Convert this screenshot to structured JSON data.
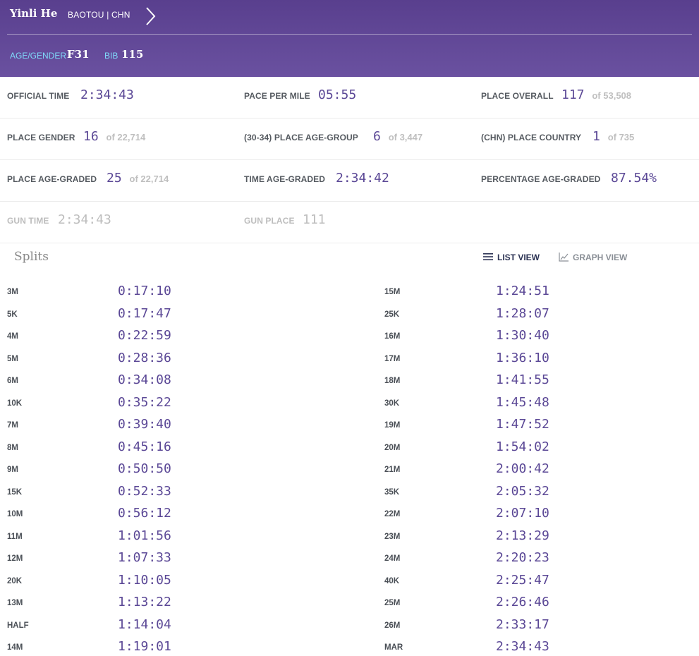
{
  "runner": {
    "name": "Yinli He",
    "location": "BAOTOU | CHN",
    "age_gender_label": "AGE/GENDER",
    "age_gender": "F31",
    "bib_label": "BIB",
    "bib": "115"
  },
  "stats": [
    [
      {
        "label": "OFFICIAL TIME",
        "value": "2:34:43",
        "of": ""
      },
      {
        "label": "PACE PER MILE",
        "value": "05:55",
        "of": ""
      },
      {
        "label": "PLACE OVERALL",
        "value": "117",
        "of": "of 53,508"
      }
    ],
    [
      {
        "label": "PLACE GENDER",
        "value": "16",
        "of": "of 22,714"
      },
      {
        "label": "(30-34) PLACE AGE-GROUP",
        "value": "6",
        "of": "of 3,447"
      },
      {
        "label": "(CHN) PLACE COUNTRY",
        "value": "1",
        "of": "of 735"
      }
    ],
    [
      {
        "label": "PLACE AGE-GRADED",
        "value": "25",
        "of": "of 22,714"
      },
      {
        "label": "TIME AGE-GRADED",
        "value": "2:34:42",
        "of": ""
      },
      {
        "label": "PERCENTAGE AGE-GRADED",
        "value": "87.54%",
        "of": ""
      }
    ],
    [
      {
        "label": "GUN TIME",
        "value": "2:34:43",
        "of": ""
      },
      {
        "label": "GUN PLACE",
        "value": "111",
        "of": ""
      }
    ]
  ],
  "splits_section": {
    "title": "Splits",
    "list_view_label": "LIST VIEW",
    "graph_view_label": "GRAPH VIEW",
    "active_view": "list"
  },
  "splits_left": [
    {
      "label": "3M",
      "time": "0:17:10"
    },
    {
      "label": "5K",
      "time": "0:17:47"
    },
    {
      "label": "4M",
      "time": "0:22:59"
    },
    {
      "label": "5M",
      "time": "0:28:36"
    },
    {
      "label": "6M",
      "time": "0:34:08"
    },
    {
      "label": "10K",
      "time": "0:35:22"
    },
    {
      "label": "7M",
      "time": "0:39:40"
    },
    {
      "label": "8M",
      "time": "0:45:16"
    },
    {
      "label": "9M",
      "time": "0:50:50"
    },
    {
      "label": "15K",
      "time": "0:52:33"
    },
    {
      "label": "10M",
      "time": "0:56:12"
    },
    {
      "label": "11M",
      "time": "1:01:56"
    },
    {
      "label": "12M",
      "time": "1:07:33"
    },
    {
      "label": "20K",
      "time": "1:10:05"
    },
    {
      "label": "13M",
      "time": "1:13:22"
    },
    {
      "label": "HALF",
      "time": "1:14:04"
    },
    {
      "label": "14M",
      "time": "1:19:01"
    }
  ],
  "splits_right": [
    {
      "label": "15M",
      "time": "1:24:51"
    },
    {
      "label": "25K",
      "time": "1:28:07"
    },
    {
      "label": "16M",
      "time": "1:30:40"
    },
    {
      "label": "17M",
      "time": "1:36:10"
    },
    {
      "label": "18M",
      "time": "1:41:55"
    },
    {
      "label": "30K",
      "time": "1:45:48"
    },
    {
      "label": "19M",
      "time": "1:47:52"
    },
    {
      "label": "20M",
      "time": "1:54:02"
    },
    {
      "label": "21M",
      "time": "2:00:42"
    },
    {
      "label": "35K",
      "time": "2:05:32"
    },
    {
      "label": "22M",
      "time": "2:07:10"
    },
    {
      "label": "23M",
      "time": "2:13:29"
    },
    {
      "label": "24M",
      "time": "2:20:23"
    },
    {
      "label": "40K",
      "time": "2:25:47"
    },
    {
      "label": "25M",
      "time": "2:26:46"
    },
    {
      "label": "26M",
      "time": "2:33:17"
    },
    {
      "label": "MAR",
      "time": "2:34:43"
    }
  ],
  "colors": {
    "header_bg": "#593f8e",
    "accent_value": "#5b4896",
    "meta_label": "#7fd8f8"
  }
}
